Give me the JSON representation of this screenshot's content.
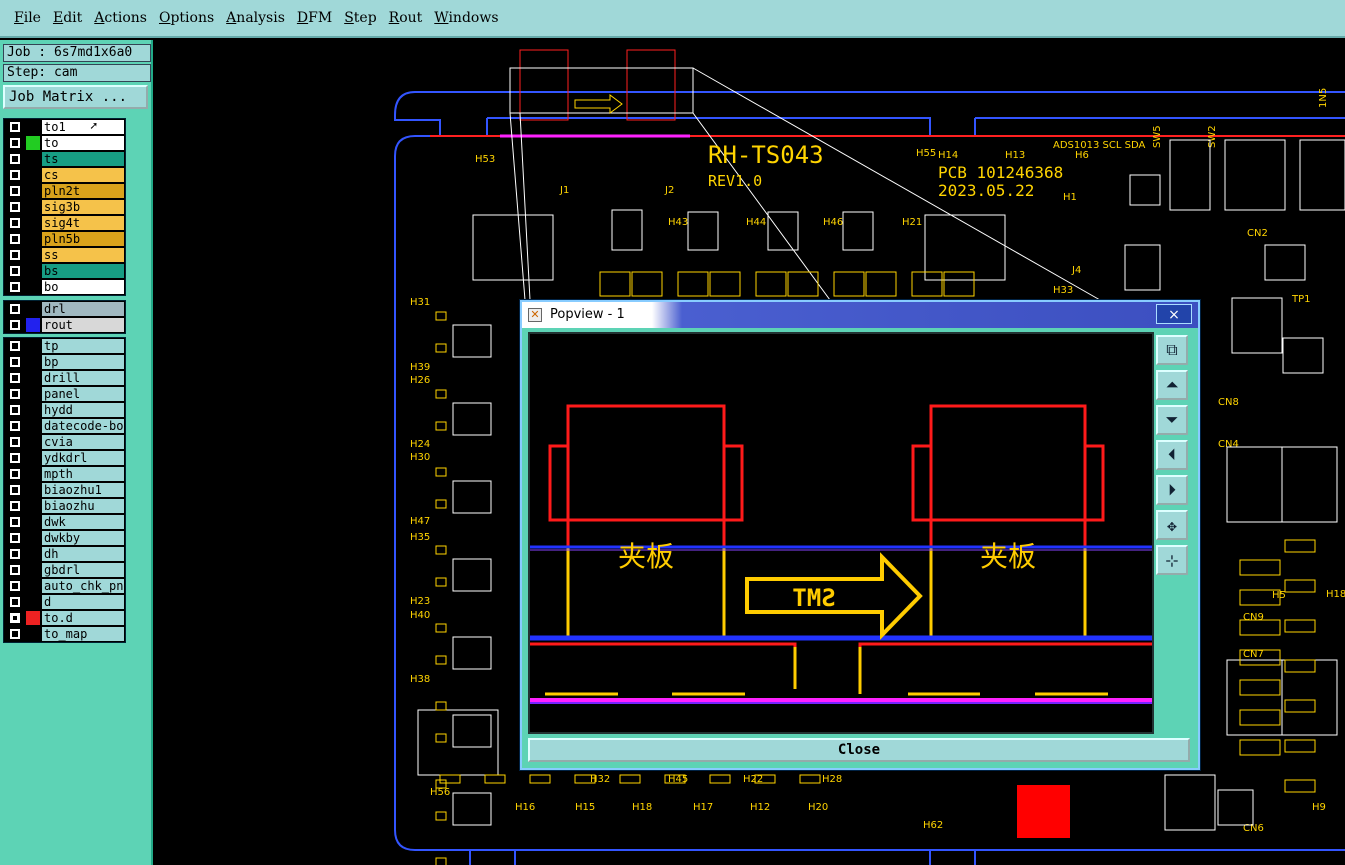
{
  "menubar": {
    "items": [
      "File",
      "Edit",
      "Actions",
      "Options",
      "Analysis",
      "DFM",
      "Step",
      "Rout",
      "Windows"
    ]
  },
  "side": {
    "job": "Job : 6s7md1x6a0",
    "step": "Step: cam",
    "job_matrix": "Job Matrix ..."
  },
  "layers_board": [
    {
      "name": "to1",
      "color": "#000000",
      "fill": "#ffffff",
      "checked": false,
      "pointer": true
    },
    {
      "name": "to",
      "color": "#22cc22",
      "fill": "#ffffff",
      "checked": false
    },
    {
      "name": "ts",
      "color": "#000000",
      "fill": "#179e84",
      "checked": false
    },
    {
      "name": "cs",
      "color": "#000000",
      "fill": "#f5c24a",
      "checked": false
    },
    {
      "name": "pln2t",
      "color": "#000000",
      "fill": "#d9a21b",
      "checked": false
    },
    {
      "name": "sig3b",
      "color": "#000000",
      "fill": "#f5c24a",
      "checked": false
    },
    {
      "name": "sig4t",
      "color": "#000000",
      "fill": "#f5c24a",
      "checked": false
    },
    {
      "name": "pln5b",
      "color": "#000000",
      "fill": "#d9a21b",
      "checked": false
    },
    {
      "name": "ss",
      "color": "#000000",
      "fill": "#f5c24a",
      "checked": false
    },
    {
      "name": "bs",
      "color": "#000000",
      "fill": "#179e84",
      "checked": false
    },
    {
      "name": "bo",
      "color": "#000000",
      "fill": "#ffffff",
      "checked": false
    }
  ],
  "layers_drill": [
    {
      "name": "drl",
      "color": "#000000",
      "fill": "#a0b8c0",
      "checked": false
    },
    {
      "name": "rout",
      "color": "#2222ee",
      "fill": "#d8d8d8",
      "checked": false
    }
  ],
  "layers_misc": [
    {
      "name": "tp",
      "fill": "#a0d8d8"
    },
    {
      "name": "bp",
      "fill": "#a0d8d8"
    },
    {
      "name": "drill",
      "fill": "#a0d8d8"
    },
    {
      "name": "panel",
      "fill": "#a0d8d8"
    },
    {
      "name": "hydd",
      "fill": "#a0d8d8"
    },
    {
      "name": "datecode-bo",
      "fill": "#a0d8d8"
    },
    {
      "name": "cvia",
      "fill": "#a0d8d8"
    },
    {
      "name": "ydkdrl",
      "fill": "#a0d8d8"
    },
    {
      "name": "mpth",
      "fill": "#a0d8d8"
    },
    {
      "name": "biaozhu1",
      "fill": "#a0d8d8"
    },
    {
      "name": "biaozhu",
      "fill": "#a0d8d8"
    },
    {
      "name": "dwk",
      "fill": "#a0d8d8"
    },
    {
      "name": "dwkby",
      "fill": "#a0d8d8"
    },
    {
      "name": "dh",
      "fill": "#a0d8d8"
    },
    {
      "name": "gbdrl",
      "fill": "#a0d8d8"
    },
    {
      "name": "auto_chk_pn",
      "fill": "#a0d8d8"
    },
    {
      "name": "d",
      "fill": "#a0d8d8"
    },
    {
      "name": "to.d",
      "fill": "#a0d8d8",
      "checked": true,
      "color": "#ee2222"
    },
    {
      "name": "to_map",
      "fill": "#a0d8d8"
    }
  ],
  "board_text": {
    "title": "RH-TS043",
    "rev": "REV1.0",
    "pcb": "PCB 101246368",
    "date": "2023.05.22",
    "sensor": "ADS1013 SCL SDA",
    "refs": [
      "H53",
      "J1",
      "J2",
      "H43",
      "H44",
      "H46",
      "H21",
      "H55",
      "H14",
      "H13",
      "H6",
      "H1",
      "J4",
      "H33",
      "H31",
      "H39",
      "H26",
      "H24",
      "H30",
      "H47",
      "H35",
      "H23",
      "H40",
      "H38",
      "H56",
      "H16",
      "H15",
      "H18",
      "H17",
      "H12",
      "H20",
      "H62",
      "H32",
      "H45",
      "H22",
      "H28",
      "CN2",
      "TP1",
      "CN8",
      "CN4",
      "CN9",
      "CN7",
      "CN6",
      "H5",
      "H9",
      "H18",
      "SW5",
      "SW2",
      "1N5"
    ]
  },
  "popview": {
    "title": "Popview - 1",
    "close_x": "×",
    "close_button": "Close",
    "label_left": "夹板",
    "label_right": "夹板",
    "arrow_text": "SMT",
    "tools": [
      "zoom-fit-icon",
      "pan-up-icon",
      "pan-down-icon",
      "pan-left-icon",
      "pan-right-icon",
      "zoom-in-icon",
      "zoom-out-icon"
    ]
  },
  "colors": {
    "menubar_bg": "#a0d8d8",
    "panel_bg": "#5dd3b5",
    "copper_red": "#ff1010",
    "silk_yellow": "#ffd400",
    "outline_blue": "#2233ff",
    "magenta": "#ff22ff"
  }
}
